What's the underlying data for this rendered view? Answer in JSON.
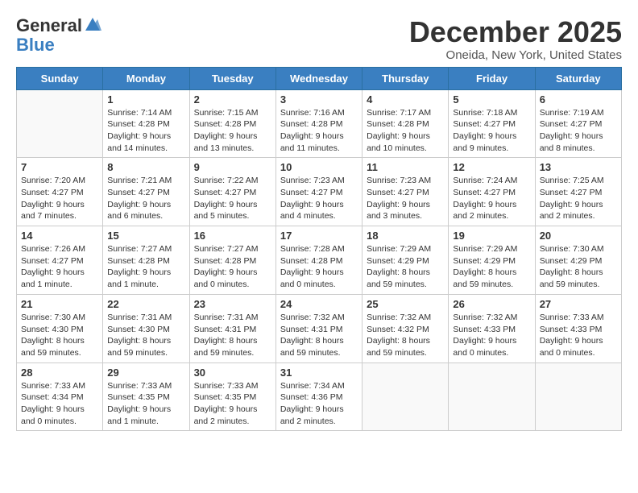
{
  "logo": {
    "general": "General",
    "blue": "Blue"
  },
  "title": "December 2025",
  "location": "Oneida, New York, United States",
  "days_of_week": [
    "Sunday",
    "Monday",
    "Tuesday",
    "Wednesday",
    "Thursday",
    "Friday",
    "Saturday"
  ],
  "weeks": [
    [
      {
        "day": "",
        "info": ""
      },
      {
        "day": "1",
        "info": "Sunrise: 7:14 AM\nSunset: 4:28 PM\nDaylight: 9 hours\nand 14 minutes."
      },
      {
        "day": "2",
        "info": "Sunrise: 7:15 AM\nSunset: 4:28 PM\nDaylight: 9 hours\nand 13 minutes."
      },
      {
        "day": "3",
        "info": "Sunrise: 7:16 AM\nSunset: 4:28 PM\nDaylight: 9 hours\nand 11 minutes."
      },
      {
        "day": "4",
        "info": "Sunrise: 7:17 AM\nSunset: 4:28 PM\nDaylight: 9 hours\nand 10 minutes."
      },
      {
        "day": "5",
        "info": "Sunrise: 7:18 AM\nSunset: 4:27 PM\nDaylight: 9 hours\nand 9 minutes."
      },
      {
        "day": "6",
        "info": "Sunrise: 7:19 AM\nSunset: 4:27 PM\nDaylight: 9 hours\nand 8 minutes."
      }
    ],
    [
      {
        "day": "7",
        "info": "Sunrise: 7:20 AM\nSunset: 4:27 PM\nDaylight: 9 hours\nand 7 minutes."
      },
      {
        "day": "8",
        "info": "Sunrise: 7:21 AM\nSunset: 4:27 PM\nDaylight: 9 hours\nand 6 minutes."
      },
      {
        "day": "9",
        "info": "Sunrise: 7:22 AM\nSunset: 4:27 PM\nDaylight: 9 hours\nand 5 minutes."
      },
      {
        "day": "10",
        "info": "Sunrise: 7:23 AM\nSunset: 4:27 PM\nDaylight: 9 hours\nand 4 minutes."
      },
      {
        "day": "11",
        "info": "Sunrise: 7:23 AM\nSunset: 4:27 PM\nDaylight: 9 hours\nand 3 minutes."
      },
      {
        "day": "12",
        "info": "Sunrise: 7:24 AM\nSunset: 4:27 PM\nDaylight: 9 hours\nand 2 minutes."
      },
      {
        "day": "13",
        "info": "Sunrise: 7:25 AM\nSunset: 4:27 PM\nDaylight: 9 hours\nand 2 minutes."
      }
    ],
    [
      {
        "day": "14",
        "info": "Sunrise: 7:26 AM\nSunset: 4:27 PM\nDaylight: 9 hours\nand 1 minute."
      },
      {
        "day": "15",
        "info": "Sunrise: 7:27 AM\nSunset: 4:28 PM\nDaylight: 9 hours\nand 1 minute."
      },
      {
        "day": "16",
        "info": "Sunrise: 7:27 AM\nSunset: 4:28 PM\nDaylight: 9 hours\nand 0 minutes."
      },
      {
        "day": "17",
        "info": "Sunrise: 7:28 AM\nSunset: 4:28 PM\nDaylight: 9 hours\nand 0 minutes."
      },
      {
        "day": "18",
        "info": "Sunrise: 7:29 AM\nSunset: 4:29 PM\nDaylight: 8 hours\nand 59 minutes."
      },
      {
        "day": "19",
        "info": "Sunrise: 7:29 AM\nSunset: 4:29 PM\nDaylight: 8 hours\nand 59 minutes."
      },
      {
        "day": "20",
        "info": "Sunrise: 7:30 AM\nSunset: 4:29 PM\nDaylight: 8 hours\nand 59 minutes."
      }
    ],
    [
      {
        "day": "21",
        "info": "Sunrise: 7:30 AM\nSunset: 4:30 PM\nDaylight: 8 hours\nand 59 minutes."
      },
      {
        "day": "22",
        "info": "Sunrise: 7:31 AM\nSunset: 4:30 PM\nDaylight: 8 hours\nand 59 minutes."
      },
      {
        "day": "23",
        "info": "Sunrise: 7:31 AM\nSunset: 4:31 PM\nDaylight: 8 hours\nand 59 minutes."
      },
      {
        "day": "24",
        "info": "Sunrise: 7:32 AM\nSunset: 4:31 PM\nDaylight: 8 hours\nand 59 minutes."
      },
      {
        "day": "25",
        "info": "Sunrise: 7:32 AM\nSunset: 4:32 PM\nDaylight: 8 hours\nand 59 minutes."
      },
      {
        "day": "26",
        "info": "Sunrise: 7:32 AM\nSunset: 4:33 PM\nDaylight: 9 hours\nand 0 minutes."
      },
      {
        "day": "27",
        "info": "Sunrise: 7:33 AM\nSunset: 4:33 PM\nDaylight: 9 hours\nand 0 minutes."
      }
    ],
    [
      {
        "day": "28",
        "info": "Sunrise: 7:33 AM\nSunset: 4:34 PM\nDaylight: 9 hours\nand 0 minutes."
      },
      {
        "day": "29",
        "info": "Sunrise: 7:33 AM\nSunset: 4:35 PM\nDaylight: 9 hours\nand 1 minute."
      },
      {
        "day": "30",
        "info": "Sunrise: 7:33 AM\nSunset: 4:35 PM\nDaylight: 9 hours\nand 2 minutes."
      },
      {
        "day": "31",
        "info": "Sunrise: 7:34 AM\nSunset: 4:36 PM\nDaylight: 9 hours\nand 2 minutes."
      },
      {
        "day": "",
        "info": ""
      },
      {
        "day": "",
        "info": ""
      },
      {
        "day": "",
        "info": ""
      }
    ]
  ]
}
